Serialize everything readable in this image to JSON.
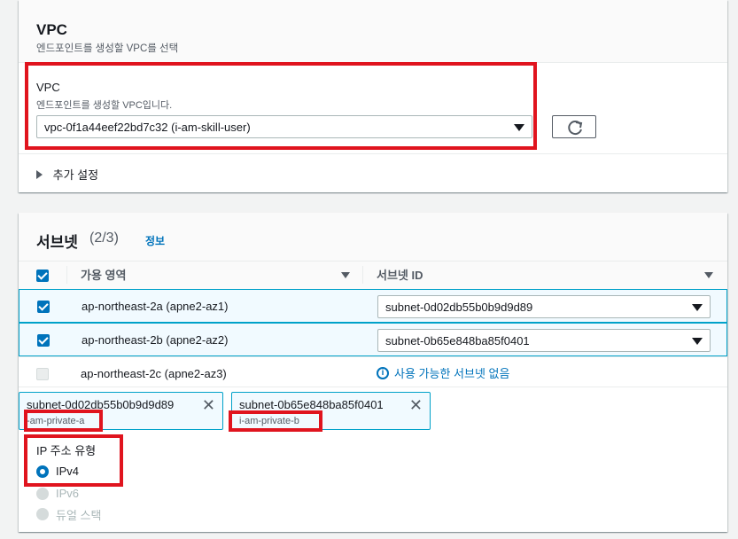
{
  "vpc_section": {
    "title": "VPC",
    "description": "엔드포인트를 생성할 VPC를 선택",
    "field_label": "VPC",
    "field_description": "엔드포인트를 생성할 VPC입니다.",
    "selected_vpc": "vpc-0f1a44eef22bd7c32 (i-am-skill-user)",
    "additional_settings_label": "추가 설정"
  },
  "subnet_section": {
    "title": "서브넷",
    "count": "(2/3)",
    "info_link": "정보",
    "columns": [
      "가용 영역",
      "서브넷 ID"
    ],
    "rows": [
      {
        "az": "ap-northeast-2a (apne2-az1)",
        "subnet": "subnet-0d02db55b0b9d9d89",
        "checked": true
      },
      {
        "az": "ap-northeast-2b (apne2-az2)",
        "subnet": "subnet-0b65e848ba85f0401",
        "checked": true
      },
      {
        "az": "ap-northeast-2c (apne2-az3)",
        "subnet": "사용 가능한 서브넷 없음",
        "checked": false
      }
    ],
    "tokens": [
      {
        "id": "subnet-0d02db55b0b9d9d89",
        "name": "-am-private-a"
      },
      {
        "id": "subnet-0b65e848ba85f0401",
        "name": "i-am-private-b"
      }
    ],
    "ip_type_label": "IP 주소 유형",
    "ip_options": [
      "IPv4",
      "IPv6",
      "듀얼 스택"
    ]
  },
  "colors": {
    "accent": "#0073bb",
    "highlight": "#e0141e",
    "selected_row_bg": "#f1faff"
  }
}
